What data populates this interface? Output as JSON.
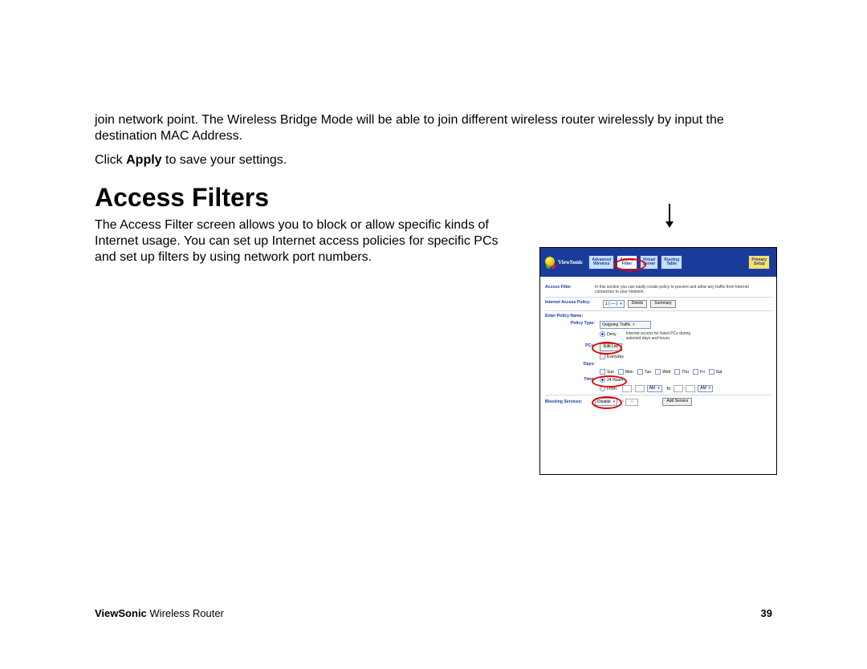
{
  "intro": {
    "line1": "join network point. The Wireless Bridge Mode will be able to join different wireless router wirelessly by input the destination MAC Address.",
    "apply_prefix": "Click ",
    "apply_bold": "Apply",
    "apply_suffix": " to save your settings."
  },
  "heading": "Access Filters",
  "desc": "The Access Filter screen allows you to block or allow specific kinds of Internet usage. You can set up Internet access policies for specific PCs and set up filters by using network port numbers.",
  "figure": {
    "brand": "ViewSonic",
    "tabs": {
      "adv": "Advanced\nWireless",
      "access": "Access\nFilter",
      "virtual": "Virtual\nServer",
      "routing": "Routing\nTable",
      "primary": "Primary\nSetup"
    },
    "section": {
      "title": "Access Filter",
      "desc": "In this section you can easily create policy to prevent and allow any traffic from Internet connection to your Network."
    },
    "policy": {
      "label": "Internet Access Policy:",
      "select": "1 ( — )",
      "delete": "Delete",
      "summary": "Summary"
    },
    "enter": {
      "label": "Enter Policy Name:",
      "type_label": "Policy Type:",
      "type_value": "Outgoing Traffic",
      "deny": "Deny",
      "deny_hint": "Internet access for listed PCs during selected days and hours.",
      "pcs_label": "PCs:",
      "edit_list": "Edit List",
      "everyday": "Everyday",
      "days_label": "Days:",
      "days": [
        "Sun",
        "Mon",
        "Tue",
        "Wed",
        "Thu",
        "Fri",
        "Sat"
      ],
      "time_label": "Time:",
      "t24": "24 Hours",
      "from": "From:",
      "to": "To:",
      "am": "AM"
    },
    "blocking": {
      "label": "Blocking Services:",
      "disable": "Disable",
      "sep": "~",
      "zero": "0",
      "add": "Add Service"
    }
  },
  "footer": {
    "brand": "ViewSonic",
    "product": " Wireless Router",
    "page": "39"
  }
}
